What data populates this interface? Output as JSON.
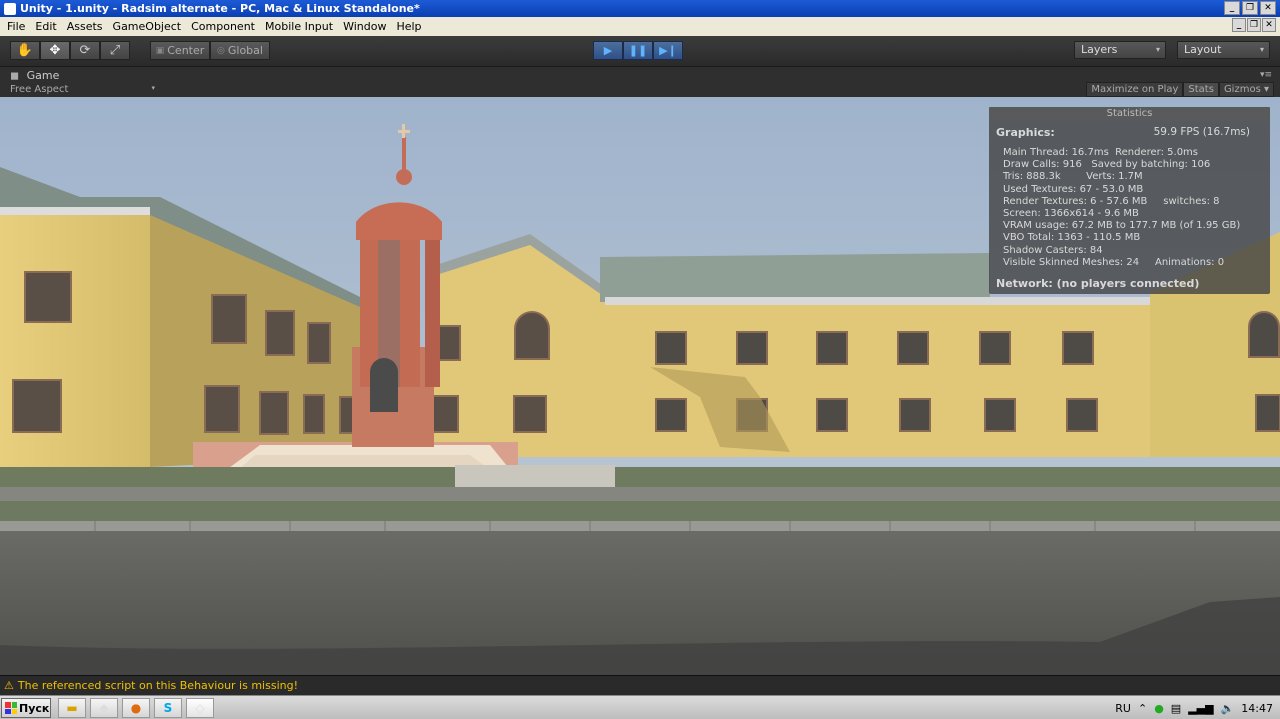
{
  "window": {
    "title": "Unity - 1.unity - Radsim alternate - PC, Mac & Linux Standalone*"
  },
  "menu": {
    "items": [
      "File",
      "Edit",
      "Assets",
      "GameObject",
      "Component",
      "Mobile Input",
      "Window",
      "Help"
    ]
  },
  "toolbar": {
    "hand_icon": "hand-icon",
    "move_icon": "move-arrows-icon",
    "rotate_icon": "rotate-icon",
    "scale_icon": "scale-icon",
    "center_label": "Center",
    "global_label": "Global",
    "play_icon": "play-icon",
    "pause_icon": "pause-icon",
    "step_icon": "step-icon",
    "layers_label": "Layers",
    "layout_label": "Layout"
  },
  "game_tab": {
    "title": "Game",
    "aspect": "Free Aspect",
    "maximize": "Maximize on Play",
    "stats": "Stats",
    "gizmos": "Gizmos"
  },
  "stats": {
    "header": "Statistics",
    "graphics_label": "Graphics:",
    "fps": "59.9 FPS (16.7ms)",
    "lines": [
      "Main Thread: 16.7ms  Renderer: 5.0ms",
      "Draw Calls: 916   Saved by batching: 106",
      "Tris: 888.3k        Verts: 1.7M",
      "Used Textures: 67 - 53.0 MB",
      "Render Textures: 6 - 57.6 MB     switches: 8",
      "Screen: 1366x614 - 9.6 MB",
      "VRAM usage: 67.2 MB to 177.7 MB (of 1.95 GB)",
      "VBO Total: 1363 - 110.5 MB",
      "Shadow Casters: 84",
      "Visible Skinned Meshes: 24     Animations: 0"
    ],
    "network": "Network: (no players connected)"
  },
  "console": {
    "message": "The referenced script on this Behaviour is missing!"
  },
  "taskbar": {
    "start_label": "Пуск",
    "language": "RU",
    "time": "14:47"
  }
}
